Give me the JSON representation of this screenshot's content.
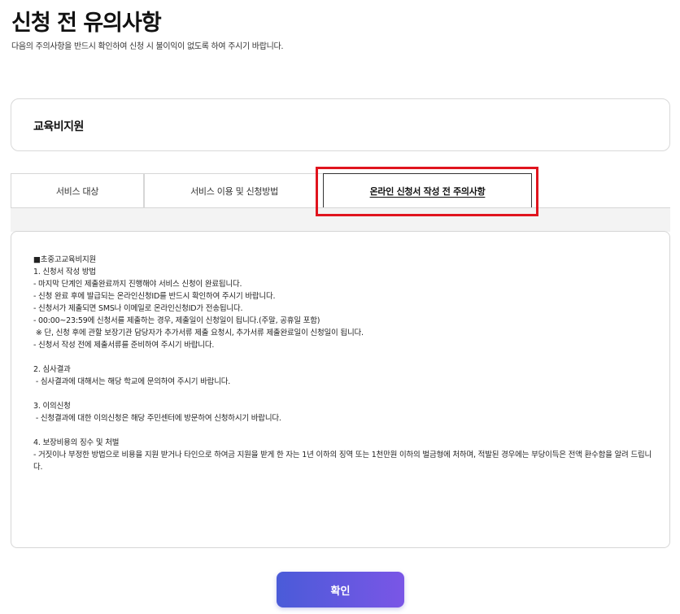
{
  "header": {
    "title": "신청 전 유의사항",
    "subtitle": "다음의 주의사항을 반드시 확인하여 신청 시 불이익이 없도록 하여 주시기 바랍니다."
  },
  "category": {
    "label": "교육비지원"
  },
  "tabs": [
    {
      "label": "서비스 대상",
      "active": false
    },
    {
      "label": "서비스 이용 및 신청방법",
      "active": false
    },
    {
      "label": "온라인 신청서 작성 전 주의사항",
      "active": true
    }
  ],
  "highlight_color": "#e0141e",
  "content": {
    "lines": [
      "■초중고교육비지원",
      "1. 신청서 작성 방법",
      "- 마지막 단계인 제출완료까지 진행해야 서비스 신청이 완료됩니다.",
      "- 신청 완료 후에 발급되는 온라인신청ID를 반드시 확인하여 주시기 바랍니다.",
      "- 신청서가 제출되면 SMS나 이메일로 온라인신청ID가 전송됩니다.",
      "- 00:00~23:59에 신청서를 제출하는 경우, 제출일이 신청일이 됩니다.(주말, 공휴일 포함)",
      " ※ 단, 신청 후에 관할 보장기관 담당자가 추가서류 제출 요청시, 추가서류 제출완료일이 신청일이 됩니다.",
      "- 신청서 작성 전에 제출서류를 준비하여 주시기 바랍니다.",
      "",
      "2. 심사결과",
      " - 심사결과에 대해서는 해당 학교에 문의하여 주시기 바랍니다.",
      "",
      "3. 이의신청",
      " - 신청결과에 대한 이의신청은 해당 주민센터에 방문하여 신청하시기 바랍니다.",
      "",
      "4. 보장비용의 징수 및 처벌",
      "- 거짓이나 부정한 방법으로 비용을 지원 받거나 타인으로 하여금 지원을 받게 한 자는 1년 이하의 징역 또는 1천만원 이하의 벌금형에 처하며, 적발된 경우에는 부당이득은 전액 환수함을 알려 드립니다."
    ]
  },
  "confirm_button": {
    "label": "확인"
  }
}
